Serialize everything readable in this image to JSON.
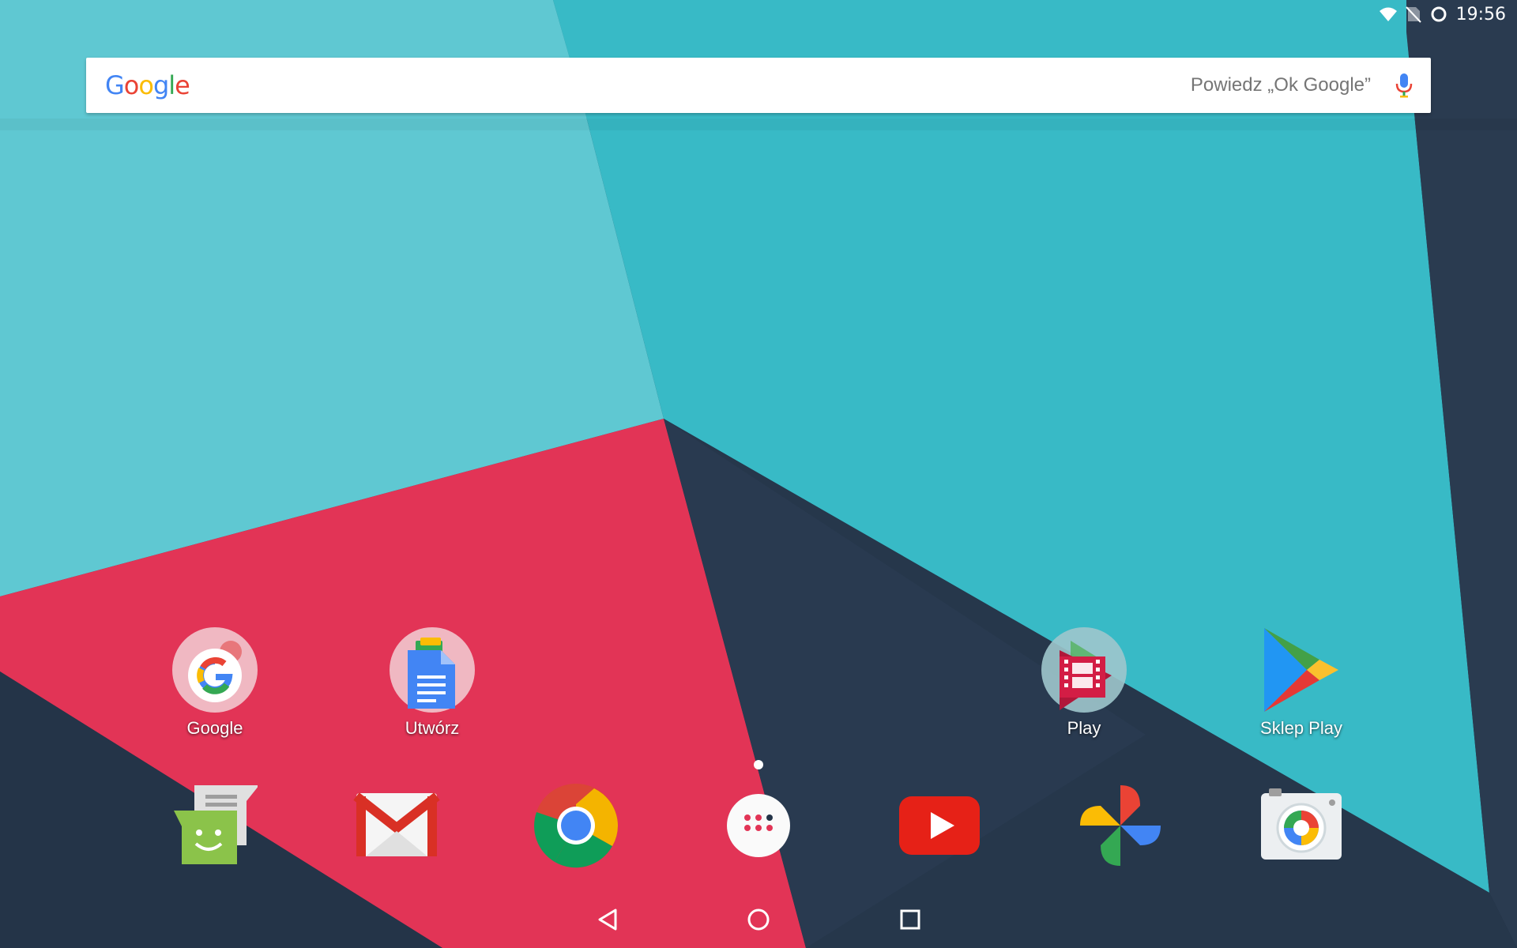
{
  "statusbar": {
    "time": "19:56",
    "icons": [
      "wifi-icon",
      "no-sim-icon",
      "sync-icon"
    ]
  },
  "search": {
    "logo": "Google",
    "hint": "Powiedz „Ok Google”",
    "icons": [
      "microphone-icon"
    ]
  },
  "home_apps": [
    {
      "label": "Google",
      "icon": "google-folder-icon"
    },
    {
      "label": "Utwórz",
      "icon": "create-folder-icon"
    },
    {
      "label": "Play",
      "icon": "play-folder-icon"
    },
    {
      "label": "Sklep Play",
      "icon": "play-store-icon"
    }
  ],
  "dock": [
    {
      "icon": "messenger-icon"
    },
    {
      "icon": "gmail-icon"
    },
    {
      "icon": "chrome-icon"
    },
    {
      "icon": "app-drawer-icon"
    },
    {
      "icon": "youtube-icon"
    },
    {
      "icon": "photos-icon"
    },
    {
      "icon": "camera-icon"
    }
  ],
  "navbar": [
    "back-icon",
    "home-icon",
    "recents-icon"
  ],
  "colors": {
    "teal_light": "#5ec9d3",
    "teal": "#3bbcc8",
    "red": "#e23456",
    "navy": "#243448",
    "google_blue": "#4285F4",
    "google_red": "#EA4335",
    "google_yellow": "#FBBC05",
    "google_green": "#34A853"
  }
}
